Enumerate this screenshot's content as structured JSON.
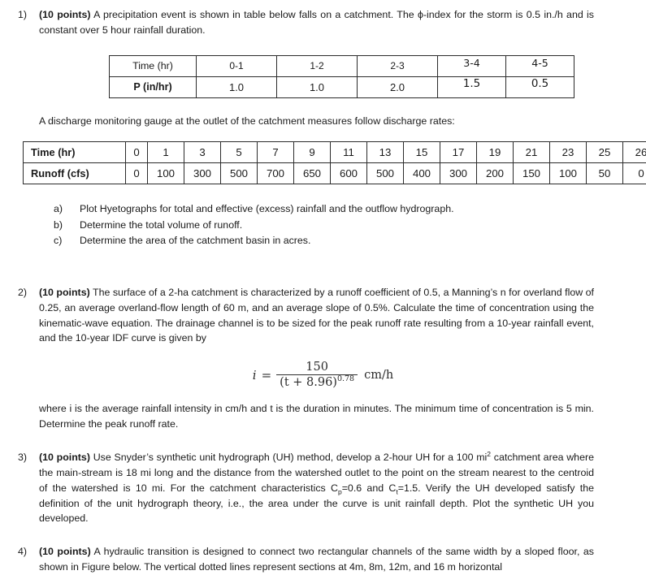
{
  "document": {
    "type": "homework-problem-set",
    "subject": "hydrology"
  },
  "problems": [
    {
      "number": "1)",
      "points_label": "(10 points)",
      "text_after_points": " A precipitation event is shown in table below falls on a catchment. The ϕ-index for the storm is 0.5 in./h and is constant over 5 hour rainfall duration."
    },
    {
      "number": "2)",
      "points_label": "(10 points)",
      "text_after_points": " The surface of a 2-ha catchment is characterized by a runoff coefficient of 0.5, a Manning’s n for overland flow of 0.25, an average overland-flow length of 60 m, and an average slope of 0.5%. Calculate the time of concentration using the kinematic-wave equation. The drainage channel is to be sized for the peak runoff rate resulting from a 10-year rainfall event, and the 10-year IDF curve is given by"
    },
    {
      "number": "3)",
      "points_label": "(10 points)",
      "text_prefix": " Use Snyder’s synthetic unit hydrograph (UH) method, develop a 2-hour UH for a 100 mi",
      "superscript": "2",
      "text_mid1": " catchment area where the main-stream is 18 mi long and the distance from the watershed outlet to the point on the stream nearest to the centroid of the watershed is 10 mi. For the catchment characteristics C",
      "sub1": "p",
      "text_mid2": "=0.6 and C",
      "sub2": "t",
      "text_suffix": "=1.5. Verify the UH developed satisfy the definition of the unit hydrograph theory, i.e., the area under the curve is unit rainfall depth. Plot the synthetic UH you developed."
    },
    {
      "number": "4)",
      "points_label": "(10 points)",
      "text_after_points": " A hydraulic transition is designed to connect two rectangular channels of the same width by a sloped floor, as shown in Figure below. The vertical dotted lines represent sections at 4m, 8m, 12m, and 16 m horizontal"
    }
  ],
  "intro_paragraph": "A discharge monitoring gauge at the outlet of the catchment measures follow discharge rates:",
  "precipitation_table": {
    "row_labels": [
      "Time (hr)",
      "P (in/hr)"
    ],
    "time_intervals": [
      "0-1",
      "1-2",
      "2-3",
      "3-4",
      "4-5"
    ],
    "precipitation_values": [
      "1.0",
      "1.0",
      "2.0",
      "1.5",
      "0.5"
    ]
  },
  "runoff_table": {
    "row_labels": [
      "Time (hr)",
      "Runoff (cfs)"
    ],
    "time_values": [
      "0",
      "1",
      "3",
      "5",
      "7",
      "9",
      "11",
      "13",
      "15",
      "17",
      "19",
      "21",
      "23",
      "25",
      "26"
    ],
    "runoff_values": [
      "0",
      "100",
      "300",
      "500",
      "700",
      "650",
      "600",
      "500",
      "400",
      "300",
      "200",
      "150",
      "100",
      "50",
      "0"
    ]
  },
  "subquestions": [
    {
      "marker": "a)",
      "text": "Plot Hyetographs for total and effective (excess) rainfall and the outflow hydrograph."
    },
    {
      "marker": "b)",
      "text": "Determine the total volume of runoff."
    },
    {
      "marker": "c)",
      "text": "Determine the area of the catchment basin in acres."
    }
  ],
  "equation": {
    "variable": "i",
    "equals": "=",
    "numerator": "150",
    "denominator_base": "(t + 8.96)",
    "denominator_exponent": "0.78",
    "units": "cm/h"
  },
  "equation_note": "where i is the average rainfall intensity in cm/h and t is the duration in minutes. The minimum time of concentration is 5 min. Determine the peak runoff rate."
}
